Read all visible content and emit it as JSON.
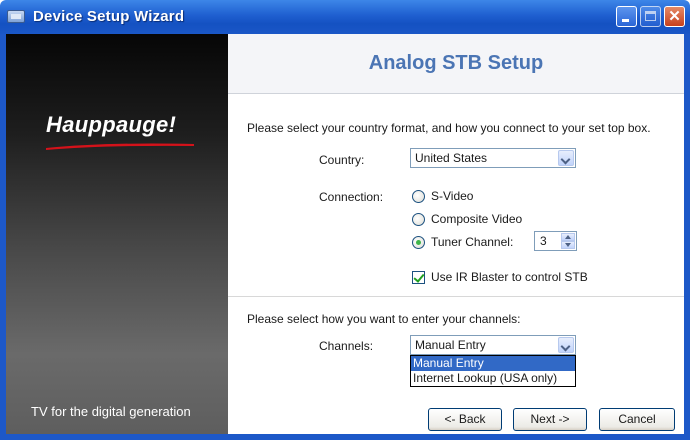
{
  "window": {
    "title": "Device Setup Wizard",
    "title_icon": "window-icon",
    "controls": {
      "minimize": "minimize-icon",
      "maximize": "maximize-icon",
      "close": "close-icon",
      "close_glyph": "✕"
    }
  },
  "sidebar": {
    "logo": "Hauppauge!",
    "tagline": "TV for the digital generation"
  },
  "page": {
    "title": "Analog STB Setup",
    "instructions": "Please select your country format, and how you connect to your set top box.",
    "country": {
      "label": "Country:",
      "value": "United States"
    },
    "connection": {
      "label": "Connection:",
      "options": [
        {
          "label": "S-Video",
          "checked": false
        },
        {
          "label": "Composite Video",
          "checked": false
        },
        {
          "label": "Tuner Channel:",
          "checked": true
        }
      ],
      "tuner_channel": "3"
    },
    "ir_blaster": {
      "label": "Use IR Blaster to control STB",
      "checked": true
    },
    "channels_instructions": "Please select how you want to enter your channels:",
    "channels": {
      "label": "Channels:",
      "value": "Manual Entry",
      "options": [
        "Manual Entry",
        "Internet Lookup (USA only)"
      ]
    }
  },
  "buttons": {
    "back": "<- Back",
    "next": "Next ->",
    "cancel": "Cancel"
  },
  "colors": {
    "title_bar": "#1f5fd0",
    "page_title": "#4b75b4",
    "selection": "#3169c6",
    "check": "#21a121"
  }
}
